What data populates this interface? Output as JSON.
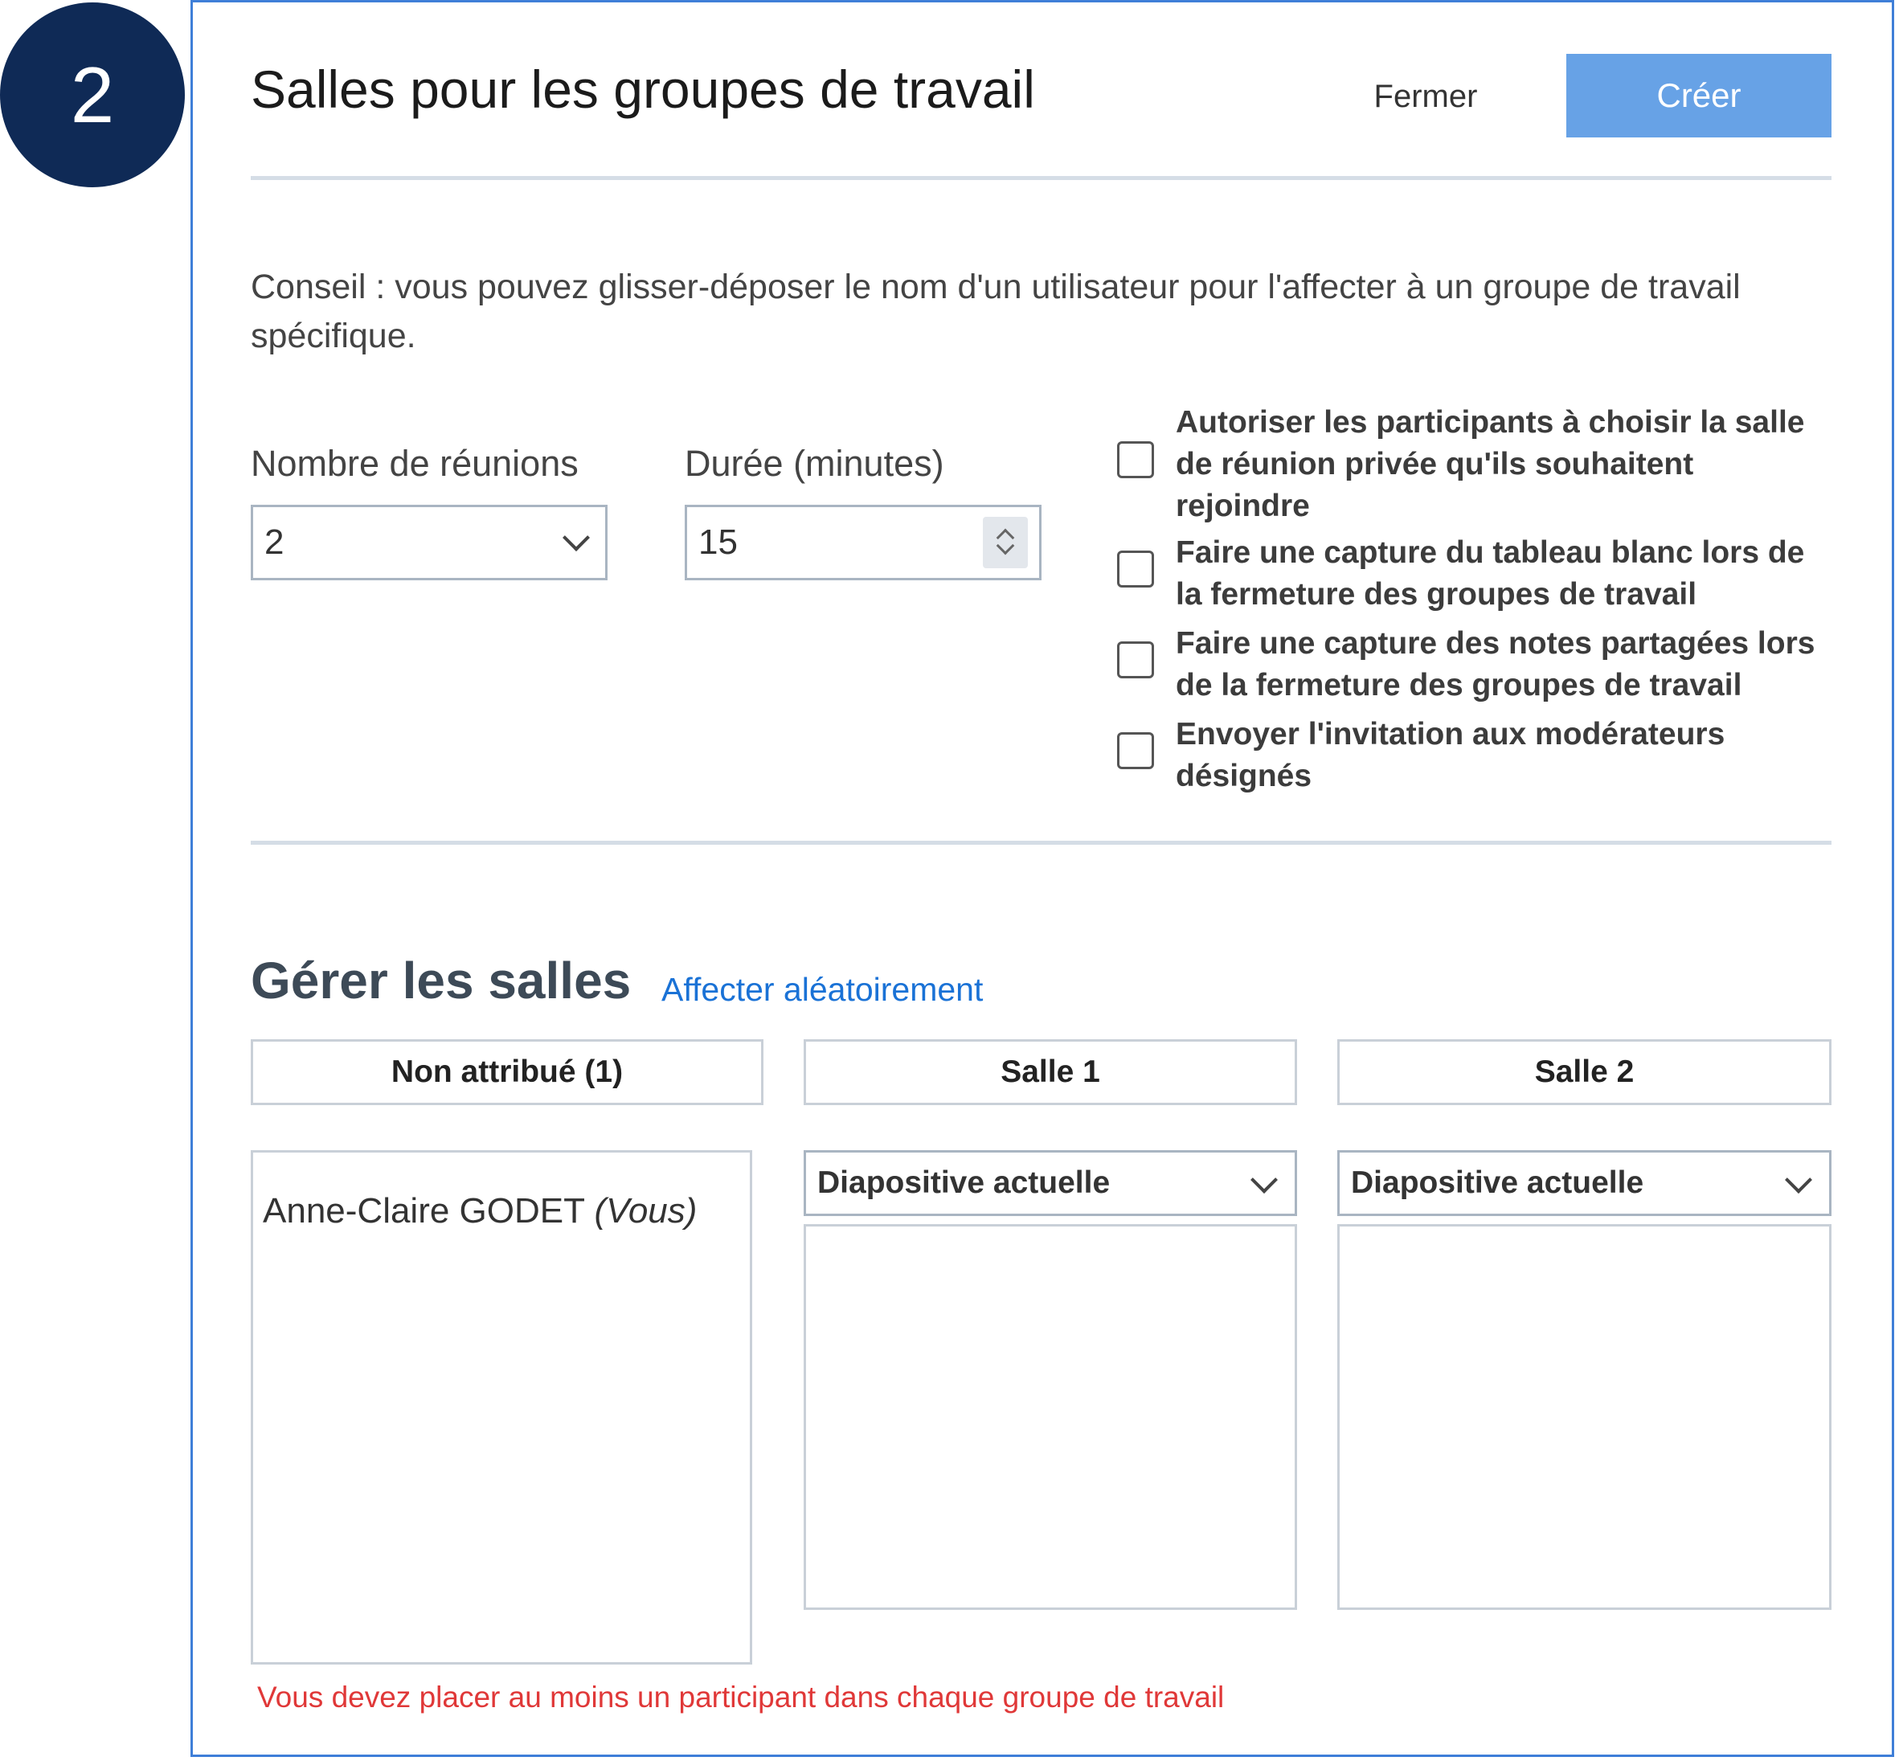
{
  "step_badge": "2",
  "dialog": {
    "title": "Salles pour les groupes de travail",
    "close_label": "Fermer",
    "create_label": "Créer",
    "tip": "Conseil : vous pouvez glisser-déposer le nom d'un utilisateur pour l'affecter à un groupe de travail spécifique."
  },
  "settings": {
    "meetings_label": "Nombre de réunions",
    "meetings_value": "2",
    "duration_label": "Durée (minutes)",
    "duration_value": "15",
    "options": [
      {
        "label": "Autoriser les participants à choisir la salle de réunion privée qu'ils souhaitent rejoindre",
        "checked": false
      },
      {
        "label": "Faire une capture du tableau blanc lors de la fermeture des groupes de travail",
        "checked": false
      },
      {
        "label": "Faire une capture des notes partagées lors de la fermeture des groupes de travail",
        "checked": false
      },
      {
        "label": "Envoyer l'invitation aux modérateurs désignés",
        "checked": false
      }
    ]
  },
  "rooms": {
    "title": "Gérer les salles",
    "random_assign_label": "Affecter aléatoirement",
    "unassigned_header": "Non attribué (1)",
    "unassigned_participants": [
      {
        "name": "Anne-Claire GODET",
        "suffix": "(Vous)"
      }
    ],
    "room1_header": "Salle 1",
    "room1_slide": "Diapositive actuelle",
    "room2_header": "Salle 2",
    "room2_slide": "Diapositive actuelle",
    "error": "Vous devez placer au moins un participant dans chaque groupe de travail"
  },
  "colors": {
    "badge": "#0f2a56",
    "dialog_border": "#3f7fd8",
    "create_button": "#67a2e6",
    "link": "#1a72d6",
    "error": "#e03838"
  }
}
